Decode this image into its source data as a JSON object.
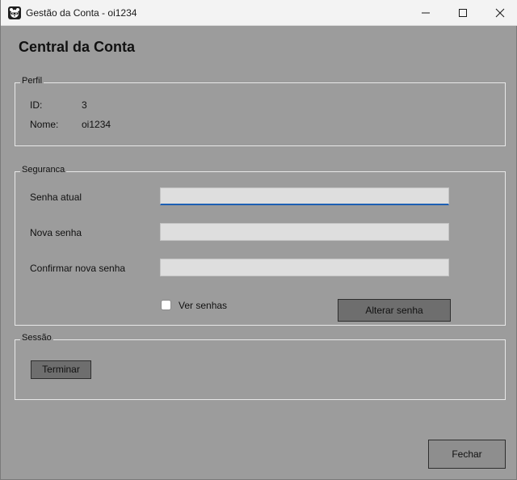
{
  "window": {
    "title": "Gestão da Conta - oi1234",
    "controls": {
      "minimize_icon": "minimize-icon",
      "maximize_icon": "maximize-icon",
      "close_icon": "close-icon"
    }
  },
  "heading": "Central da Conta",
  "perfil": {
    "legend": "Perfil",
    "id_label": "ID:",
    "id_value": "3",
    "name_label": "Nome:",
    "name_value": "oi1234"
  },
  "seguranca": {
    "legend": "Seguranca",
    "current_password_label": "Senha atual",
    "current_password_value": "",
    "new_password_label": "Nova senha",
    "new_password_value": "",
    "confirm_password_label": "Confirmar nova senha",
    "confirm_password_value": "",
    "show_passwords_label": "Ver senhas",
    "show_passwords_checked": false,
    "change_password_button": "Alterar senha"
  },
  "sessao": {
    "legend": "Sessão",
    "end_button": "Terminar"
  },
  "footer": {
    "close_button": "Fechar"
  },
  "colors": {
    "window_background": "#9c9c9c",
    "titlebar_background": "#f3f3f3",
    "textbox_background": "#dedede",
    "focus_accent": "#1d5fb3",
    "button_background": "#6e6e6e"
  }
}
